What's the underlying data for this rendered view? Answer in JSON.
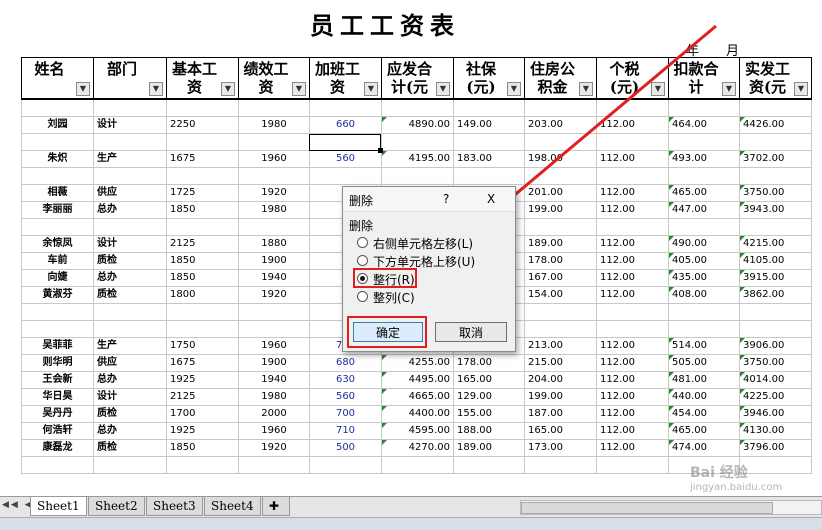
{
  "title": "员工工资表",
  "date": {
    "year": "年",
    "month": "月"
  },
  "headers": [
    {
      "label": "姓名"
    },
    {
      "label": "部门"
    },
    {
      "label": "基本工资"
    },
    {
      "label": "绩效工资"
    },
    {
      "label": "加班工资"
    },
    {
      "label": "应发合计(元"
    },
    {
      "label": "社保(元)"
    },
    {
      "label": "住房公积金"
    },
    {
      "label": "个税(元)"
    },
    {
      "label": "扣款合计"
    },
    {
      "label": "实发工资(元"
    }
  ],
  "rows": [
    {
      "blank": true
    },
    {
      "name": "刘园",
      "dept": "设计",
      "base": "2250",
      "perf": "1980",
      "ot": "660",
      "gross": "4890.00",
      "social": "149.00",
      "fund": "203.00",
      "tax": "112.00",
      "deduct": "464.00",
      "net": "4426.00"
    },
    {
      "blank": true
    },
    {
      "name": "朱炽",
      "dept": "生产",
      "base": "1675",
      "perf": "1960",
      "ot": "560",
      "gross": "4195.00",
      "social": "183.00",
      "fund": "198.00",
      "tax": "112.00",
      "deduct": "493.00",
      "net": "3702.00"
    },
    {
      "blank": true
    },
    {
      "name": "相薇",
      "dept": "供应",
      "base": "1725",
      "perf": "1920",
      "ot": "5",
      "gross": "",
      "social": "",
      "fund": "201.00",
      "tax": "112.00",
      "deduct": "465.00",
      "net": "3750.00"
    },
    {
      "name": "李丽丽",
      "dept": "总办",
      "base": "1850",
      "perf": "1980",
      "ot": "5",
      "gross": "",
      "social": "",
      "fund": "199.00",
      "tax": "112.00",
      "deduct": "447.00",
      "net": "3943.00"
    },
    {
      "blank": true
    },
    {
      "name": "余惊凤",
      "dept": "设计",
      "base": "2125",
      "perf": "1880",
      "ot": "7",
      "gross": "",
      "social": "",
      "fund": "189.00",
      "tax": "112.00",
      "deduct": "490.00",
      "net": "4215.00"
    },
    {
      "name": "车前",
      "dept": "质检",
      "base": "1850",
      "perf": "1900",
      "ot": "7",
      "gross": "",
      "social": "",
      "fund": "178.00",
      "tax": "112.00",
      "deduct": "405.00",
      "net": "4105.00"
    },
    {
      "name": "向婕",
      "dept": "总办",
      "base": "1850",
      "perf": "1940",
      "ot": "5",
      "gross": "",
      "social": "",
      "fund": "167.00",
      "tax": "112.00",
      "deduct": "435.00",
      "net": "3915.00"
    },
    {
      "name": "黄淑芬",
      "dept": "质检",
      "base": "1800",
      "perf": "1920",
      "ot": "5",
      "gross": "",
      "social": "",
      "fund": "154.00",
      "tax": "112.00",
      "deduct": "408.00",
      "net": "3862.00"
    },
    {
      "blank": true
    },
    {
      "blank": true
    },
    {
      "name": "吴菲菲",
      "dept": "生产",
      "base": "1750",
      "perf": "1960",
      "ot": "710",
      "gross": "4420.00",
      "social": "189.00",
      "fund": "213.00",
      "tax": "112.00",
      "deduct": "514.00",
      "net": "3906.00"
    },
    {
      "name": "则华明",
      "dept": "供应",
      "base": "1675",
      "perf": "1900",
      "ot": "680",
      "gross": "4255.00",
      "social": "178.00",
      "fund": "215.00",
      "tax": "112.00",
      "deduct": "505.00",
      "net": "3750.00"
    },
    {
      "name": "王会新",
      "dept": "总办",
      "base": "1925",
      "perf": "1940",
      "ot": "630",
      "gross": "4495.00",
      "social": "165.00",
      "fund": "204.00",
      "tax": "112.00",
      "deduct": "481.00",
      "net": "4014.00"
    },
    {
      "name": "华日昊",
      "dept": "设计",
      "base": "2125",
      "perf": "1980",
      "ot": "560",
      "gross": "4665.00",
      "social": "129.00",
      "fund": "199.00",
      "tax": "112.00",
      "deduct": "440.00",
      "net": "4225.00"
    },
    {
      "name": "吴丹丹",
      "dept": "质检",
      "base": "1700",
      "perf": "2000",
      "ot": "700",
      "gross": "4400.00",
      "social": "155.00",
      "fund": "187.00",
      "tax": "112.00",
      "deduct": "454.00",
      "net": "3946.00"
    },
    {
      "name": "何浩轩",
      "dept": "总办",
      "base": "1925",
      "perf": "1960",
      "ot": "710",
      "gross": "4595.00",
      "social": "188.00",
      "fund": "165.00",
      "tax": "112.00",
      "deduct": "465.00",
      "net": "4130.00"
    },
    {
      "name": "康磊龙",
      "dept": "质检",
      "base": "1850",
      "perf": "1920",
      "ot": "500",
      "gross": "4270.00",
      "social": "189.00",
      "fund": "173.00",
      "tax": "112.00",
      "deduct": "474.00",
      "net": "3796.00"
    },
    {
      "blank": true
    }
  ],
  "dialog": {
    "title": "删除",
    "help": "?",
    "close": "X",
    "group_label": "删除",
    "options": [
      {
        "label": "右侧单元格左移(L)",
        "selected": false
      },
      {
        "label": "下方单元格上移(U)",
        "selected": false
      },
      {
        "label": "整行(R)",
        "selected": true
      },
      {
        "label": "整列(C)",
        "selected": false
      }
    ],
    "ok": "确定",
    "cancel": "取消"
  },
  "sheets": [
    "Sheet1",
    "Sheet2",
    "Sheet3",
    "Sheet4"
  ],
  "active_sheet": "Sheet1",
  "nav": "◀◀ ◀ ▶ ▶▶",
  "watermark": "Bai 经验",
  "watermark_url": "jingyan.baidu.com",
  "colors": {
    "highlight": "#e02020",
    "ot_text": "#1f2f9a",
    "ok_button": "#dcecfc"
  }
}
